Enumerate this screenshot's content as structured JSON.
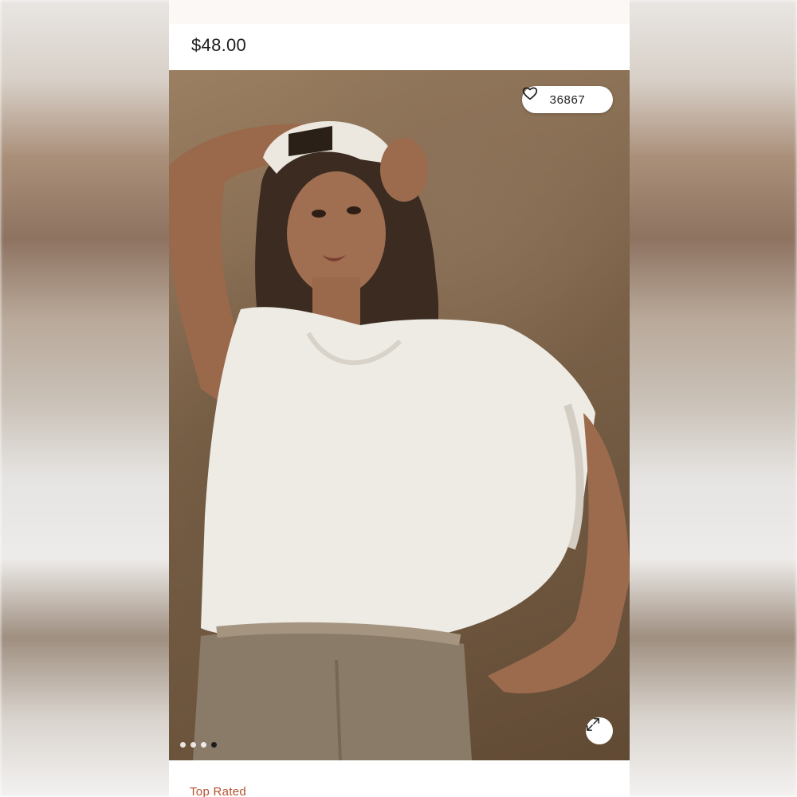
{
  "product": {
    "price": "$48.00",
    "badge": "Top Rated"
  },
  "gallery": {
    "like_count": "36867",
    "like_icon": "heart-outline-icon",
    "expand_icon": "expand-arrows-icon",
    "slide_count": 4,
    "active_slide": 4,
    "image_description_colors": {
      "backdrop": "#7a6148",
      "shirt": "#f1efea",
      "pants": "#8a7a68",
      "skin": "#9c6b4e",
      "hair": "#3a2a20"
    }
  },
  "colors": {
    "badge": "#b5502e",
    "price_text": "#1c1c1c",
    "active_dot": "#1c1c1c"
  }
}
